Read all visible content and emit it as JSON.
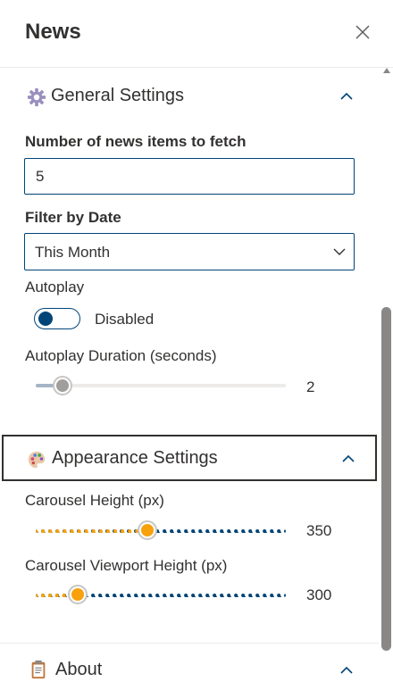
{
  "panel": {
    "title": "News"
  },
  "general": {
    "title": "General Settings",
    "items_label": "Number of news items to fetch",
    "items_value": "5",
    "filter_label": "Filter by Date",
    "filter_value": "This Month",
    "autoplay_label": "Autoplay",
    "autoplay_state": "Disabled",
    "duration_label": "Autoplay Duration (seconds)",
    "duration_value": "2"
  },
  "appearance": {
    "title": "Appearance Settings",
    "height_label": "Carousel Height (px)",
    "height_value": "350",
    "viewport_label": "Carousel Viewport Height (px)",
    "viewport_value": "300"
  },
  "about": {
    "title": "About"
  },
  "icons": {
    "close": "close-icon",
    "general": "gear-icon",
    "appearance": "palette-icon",
    "about": "clipboard-icon",
    "chevron": "chevron-up-icon"
  },
  "colors": {
    "accent": "#004578",
    "slider_fill": "#f7a10d",
    "muted_rail": "#c8c6c4",
    "text": "#323130"
  }
}
